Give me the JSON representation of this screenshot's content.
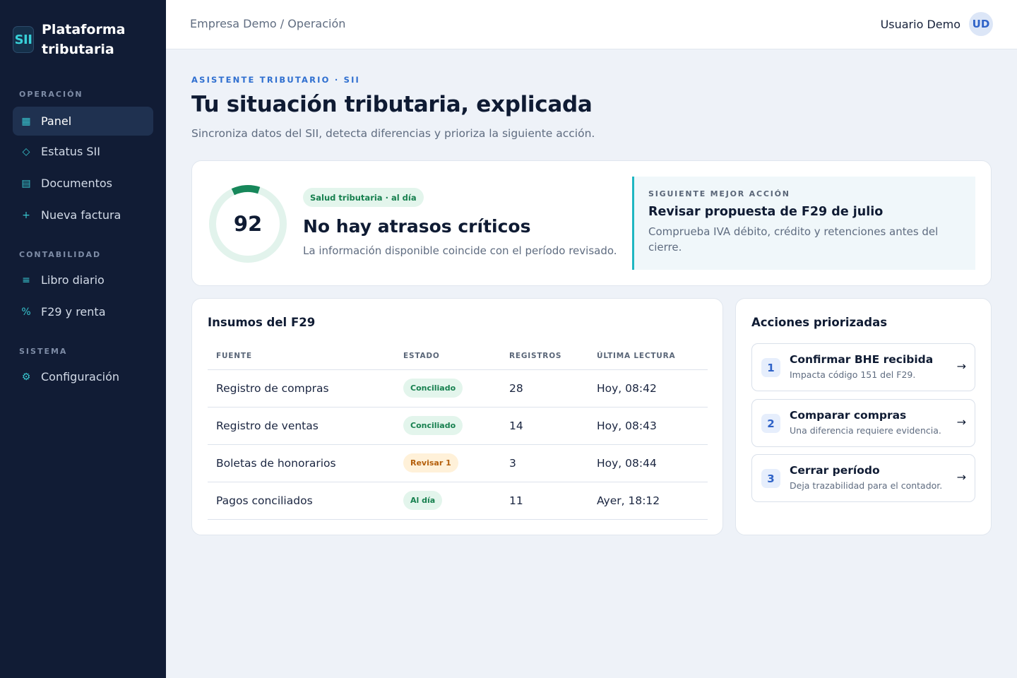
{
  "brand": {
    "logo": "SII",
    "name": "Plataforma tributaria"
  },
  "nav": {
    "sections": [
      {
        "label": "OPERACIÓN",
        "items": [
          {
            "label": "Panel",
            "icon": "▦",
            "icon_name": "grid-icon",
            "active": true
          },
          {
            "label": "Estatus SII",
            "icon": "◇",
            "icon_name": "diamond-icon"
          },
          {
            "label": "Documentos",
            "icon": "▤",
            "icon_name": "document-icon"
          },
          {
            "label": "Nueva factura",
            "icon": "+",
            "icon_name": "plus-icon"
          }
        ]
      },
      {
        "label": "CONTABILIDAD",
        "items": [
          {
            "label": "Libro diario",
            "icon": "≡",
            "icon_name": "list-icon"
          },
          {
            "label": "F29 y renta",
            "icon": "%",
            "icon_name": "percent-icon"
          }
        ]
      },
      {
        "label": "SISTEMA",
        "items": [
          {
            "label": "Configuración",
            "icon": "⚙",
            "icon_name": "gear-icon"
          }
        ]
      }
    ]
  },
  "topbar": {
    "breadcrumb": "Empresa Demo / Operación",
    "user_name": "Usuario Demo",
    "user_initials": "UD"
  },
  "header": {
    "eyebrow": "ASISTENTE TRIBUTARIO · SII",
    "title": "Tu situación tributaria, explicada",
    "subtitle": "Sincroniza datos del SII, detecta diferencias y prioriza la siguiente acción."
  },
  "health": {
    "score": "92",
    "score_fraction": 0.12,
    "badge": "Salud tributaria · al día",
    "title": "No hay atrasos críticos",
    "description": "La información disponible coincide con el período revisado.",
    "next_label": "SIGUIENTE MEJOR ACCIÓN",
    "next_title": "Revisar propuesta de F29 de julio",
    "next_description": "Comprueba IVA débito, crédito y retenciones antes del cierre."
  },
  "inputs": {
    "title": "Insumos del F29",
    "columns": [
      "FUENTE",
      "ESTADO",
      "REGISTROS",
      "ÚLTIMA LECTURA"
    ],
    "rows": [
      {
        "source": "Registro de compras",
        "status": "Conciliado",
        "status_type": "ok",
        "records": "28",
        "last_read": "Hoy, 08:42"
      },
      {
        "source": "Registro de ventas",
        "status": "Conciliado",
        "status_type": "ok",
        "records": "14",
        "last_read": "Hoy, 08:43"
      },
      {
        "source": "Boletas de honorarios",
        "status": "Revisar 1",
        "status_type": "warn",
        "records": "3",
        "last_read": "Hoy, 08:44"
      },
      {
        "source": "Pagos conciliados",
        "status": "Al día",
        "status_type": "ok",
        "records": "11",
        "last_read": "Ayer, 18:12"
      }
    ]
  },
  "actions": {
    "title": "Acciones priorizadas",
    "items": [
      {
        "num": "1",
        "title": "Confirmar BHE recibida",
        "description": "Impacta código 151 del F29.",
        "arrow": "→"
      },
      {
        "num": "2",
        "title": "Comparar compras",
        "description": "Una diferencia requiere evidencia.",
        "arrow": "→"
      },
      {
        "num": "3",
        "title": "Cerrar período",
        "description": "Deja trazabilidad para el contador.",
        "arrow": "→"
      }
    ]
  },
  "colors": {
    "sidebar": "#111c35",
    "accent": "#2f6fd0",
    "teal": "#1fb6c2",
    "success": "#17804f",
    "warning": "#b45f0b",
    "gauge": "#17875a",
    "gauge_track": "#e2f3ec"
  }
}
